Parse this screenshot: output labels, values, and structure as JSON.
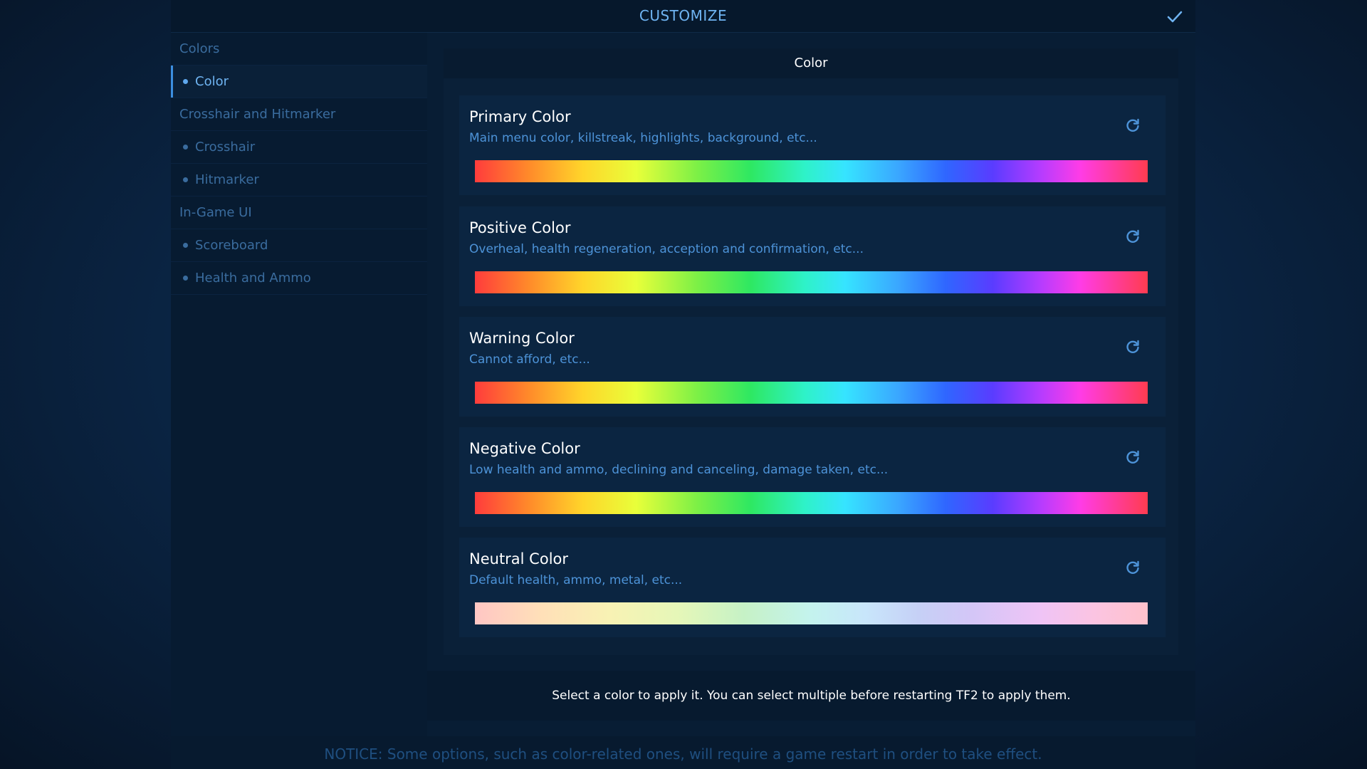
{
  "header": {
    "title": "CUSTOMIZE",
    "confirm_icon": "checkmark-icon"
  },
  "sidebar": {
    "items": [
      {
        "type": "group",
        "label": "Colors"
      },
      {
        "type": "item",
        "label": "Color",
        "active": true
      },
      {
        "type": "group",
        "label": "Crosshair and Hitmarker"
      },
      {
        "type": "item",
        "label": "Crosshair",
        "active": false
      },
      {
        "type": "item",
        "label": "Hitmarker",
        "active": false
      },
      {
        "type": "group",
        "label": "In-Game UI"
      },
      {
        "type": "item",
        "label": "Scoreboard",
        "active": false
      },
      {
        "type": "item",
        "label": "Health and Ammo",
        "active": false
      }
    ]
  },
  "panel": {
    "title": "Color",
    "cards": [
      {
        "name": "Primary Color",
        "description": "Main menu color, killstreak, highlights, background, etc...",
        "palette": "rainbow"
      },
      {
        "name": "Positive Color",
        "description": "Overheal, health regeneration, acception and confirmation, etc...",
        "palette": "rainbow"
      },
      {
        "name": "Warning Color",
        "description": "Cannot afford, etc...",
        "palette": "rainbow"
      },
      {
        "name": "Negative Color",
        "description": "Low health and ammo, declining and canceling, damage taken, etc...",
        "palette": "rainbow"
      },
      {
        "name": "Neutral Color",
        "description": "Default health, ammo, metal, etc...",
        "palette": "pastel"
      }
    ],
    "reset_icon": "refresh-icon"
  },
  "hint": "Select a color to apply it. You can select multiple before restarting TF2 to apply them.",
  "notice": "NOTICE: Some options, such as color-related ones, will require a game restart in order to take effect.",
  "colors": {
    "accent": "#6fb4f2",
    "link": "#4d93d8",
    "muted": "#3a6c9e",
    "notice": "#1f4f80"
  }
}
